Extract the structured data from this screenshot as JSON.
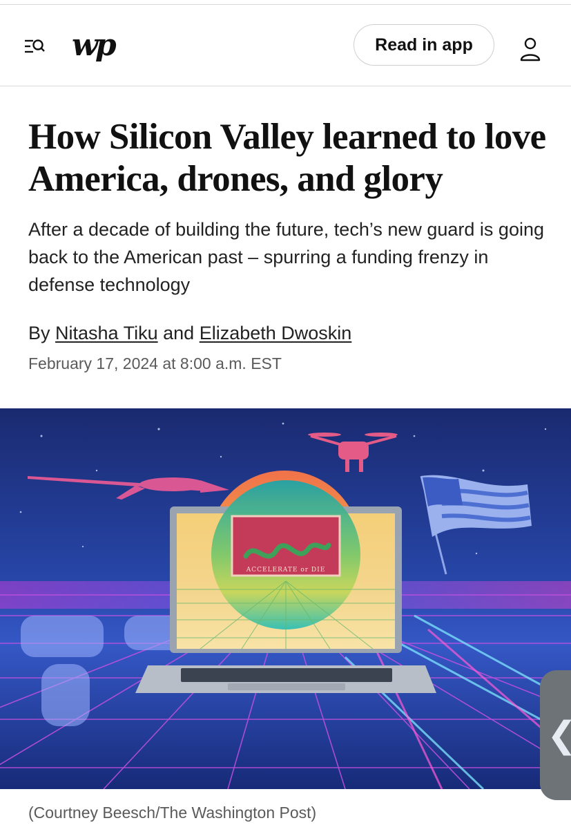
{
  "header": {
    "logo_text": "wp",
    "read_in_app_label": "Read in app"
  },
  "article": {
    "headline": "How Silicon Valley learned to love America, drones, and glory",
    "dek": "After a decade of building the future, tech’s new guard is going back to the American past – spurring a funding frenzy in defense technology",
    "byline_prefix": "By",
    "author_1": "Nitasha Tiku",
    "byline_joiner": "and",
    "author_2": "Elizabeth Dwoskin",
    "date": "February 17, 2024 at 8:00 a.m. EST"
  },
  "hero": {
    "laptop_screen_text": "ACCELERATE or DIE",
    "caption": "(Courtney Beesch/The Washington Post)"
  },
  "side_tab": {
    "icon": "chevron-left-icon"
  },
  "colors": {
    "hero_sky_top": "#1d2f7a",
    "hero_sky_bottom": "#2a4bb0",
    "grid_magenta": "#e44fd6",
    "sun_orange": "#f07a4a",
    "screen_yellow": "#f6d98a"
  }
}
